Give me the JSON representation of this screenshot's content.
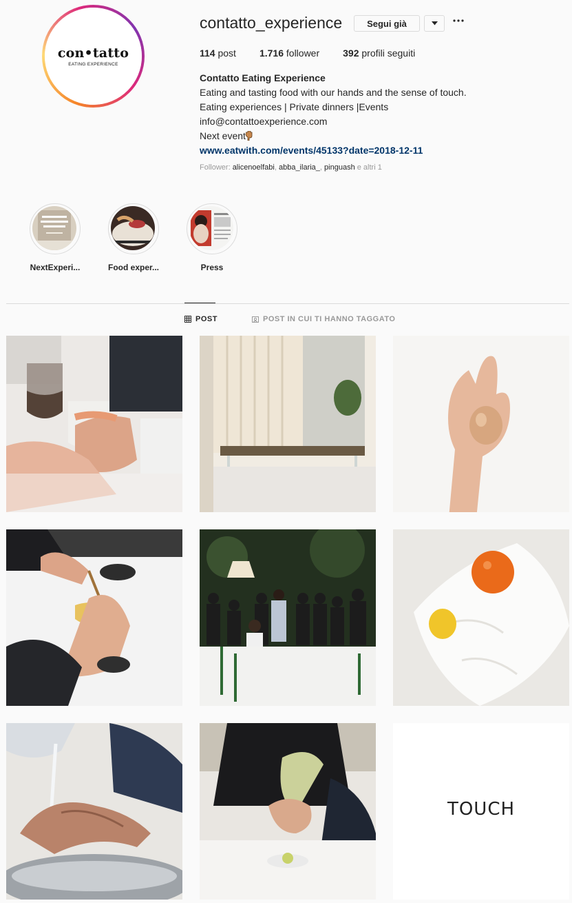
{
  "profile": {
    "username": "contatto_experience",
    "follow_button": "Segui già",
    "dropdown_icon": "caret-down-icon",
    "more_icon": "more-options-icon",
    "logo": {
      "main": "con•tatto",
      "sub": "EATING EXPERIENCE"
    }
  },
  "stats": {
    "posts_count": "114",
    "posts_label": "post",
    "followers_count": "1.716",
    "followers_label": "follower",
    "following_count": "392",
    "following_label": "profili seguiti"
  },
  "bio": {
    "name": "Contatto Eating Experience",
    "line1": "Eating and tasting food with our hands and the sense of touch.",
    "line2": "Eating experiences | Private dinners |Events",
    "email": "info@contattoexperience.com",
    "line4": "Next event",
    "line4_icon": "pointing-down-hand-icon",
    "link": "www.eatwith.com/events/45133?date=2018-12-11"
  },
  "followed_by": {
    "prefix": "Follower:",
    "user1": "alicenoelfabi",
    "user2": "abba_ilaria_",
    "user3": "pinguash",
    "suffix": "e altri 1"
  },
  "highlights": [
    {
      "label": "NextExperi..."
    },
    {
      "label": "Food exper..."
    },
    {
      "label": "Press"
    }
  ],
  "tabs": {
    "post": "POST",
    "tagged": "POST IN CUI TI HANNO TAGGATO",
    "post_icon": "grid-icon",
    "tagged_icon": "tagged-user-icon"
  },
  "posts": {
    "touch_text": "TOUCH"
  },
  "colors": {
    "background": "#fafafa",
    "link": "#003569",
    "border": "#dbdbdb",
    "muted": "#999999",
    "text": "#262626"
  }
}
